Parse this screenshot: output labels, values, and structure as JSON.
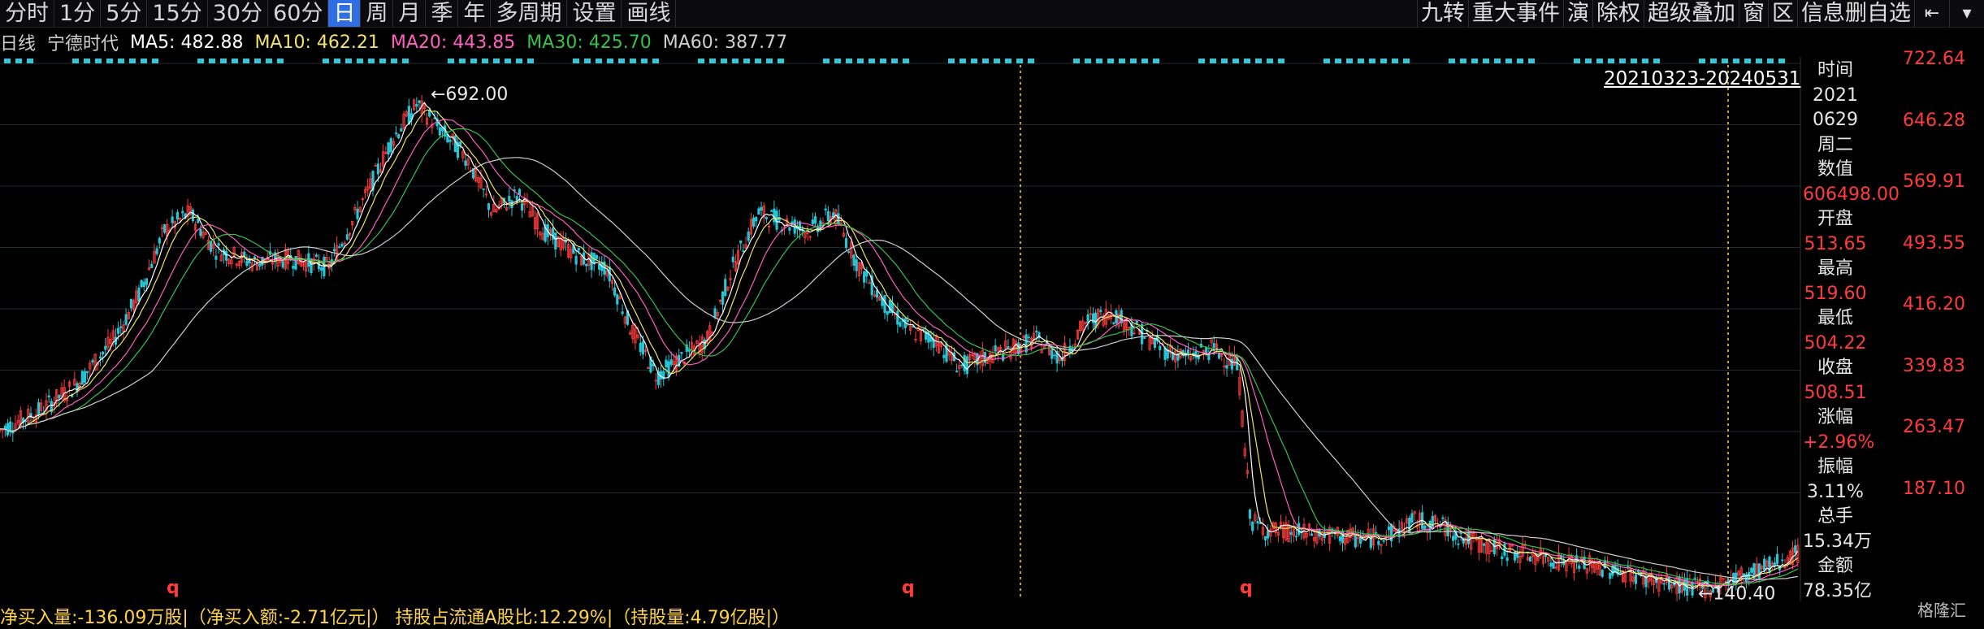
{
  "toolbar": {
    "periods": [
      "分时",
      "1分",
      "5分",
      "15分",
      "30分",
      "60分",
      "日",
      "周",
      "月",
      "季",
      "年",
      "多周期",
      "设置",
      "画线"
    ],
    "active_period": "日",
    "right_items": [
      "九转",
      "重大事件",
      "演",
      "除权",
      "超级叠加",
      "窗",
      "区",
      "信息删自选"
    ]
  },
  "legend": {
    "period": "日线",
    "stock_name": "宁德时代",
    "ma5": "MA5: 482.88",
    "ma10": "MA10: 462.21",
    "ma20": "MA20: 443.85",
    "ma30": "MA30: 425.70",
    "ma60": "MA60: 387.77",
    "colors": {
      "ma5": "#ffffff",
      "ma10": "#f0e26b",
      "ma20": "#ff5fbf",
      "ma30": "#36c24a",
      "ma60": "#cfcfcf"
    }
  },
  "range_label": "20210323-20240531",
  "info_panel": {
    "time_label": "时间",
    "year": "2021",
    "date": "0629",
    "weekday": "周二",
    "value_label": "数值",
    "value": "606498.00",
    "open_label": "开盘",
    "open": "513.65",
    "high_label": "最高",
    "high": "519.60",
    "low_label": "最低",
    "low": "504.22",
    "close_label": "收盘",
    "close": "508.51",
    "change_label": "涨幅",
    "change": "+2.96%",
    "amplitude_label": "振幅",
    "amplitude": "3.11%",
    "volume_label": "总手",
    "volume": "15.34万",
    "amount_label": "金额",
    "amount": "78.35亿"
  },
  "chart_data": {
    "type": "candlestick",
    "y_ticks": [
      "722.64",
      "646.28",
      "569.91",
      "493.55",
      "416.20",
      "339.83",
      "263.47",
      "187.10"
    ],
    "ylim": [
      140,
      725
    ],
    "max_label": "692.00",
    "min_label": "140.40",
    "markers": [
      "q",
      "q",
      "q"
    ],
    "trend_points": [
      [
        0,
        320
      ],
      [
        30,
        340
      ],
      [
        60,
        370
      ],
      [
        90,
        420
      ],
      [
        110,
        470
      ],
      [
        130,
        540
      ],
      [
        150,
        560
      ],
      [
        170,
        520
      ],
      [
        200,
        505
      ],
      [
        230,
        510
      ],
      [
        260,
        500
      ],
      [
        290,
        580
      ],
      [
        310,
        640
      ],
      [
        330,
        680
      ],
      [
        350,
        650
      ],
      [
        370,
        620
      ],
      [
        390,
        560
      ],
      [
        410,
        580
      ],
      [
        430,
        540
      ],
      [
        460,
        510
      ],
      [
        480,
        500
      ],
      [
        500,
        430
      ],
      [
        520,
        380
      ],
      [
        540,
        400
      ],
      [
        560,
        420
      ],
      [
        580,
        500
      ],
      [
        600,
        560
      ],
      [
        620,
        550
      ],
      [
        640,
        540
      ],
      [
        660,
        560
      ],
      [
        680,
        500
      ],
      [
        700,
        460
      ],
      [
        720,
        430
      ],
      [
        740,
        420
      ],
      [
        760,
        390
      ],
      [
        780,
        400
      ],
      [
        800,
        410
      ],
      [
        820,
        420
      ],
      [
        840,
        400
      ],
      [
        860,
        440
      ],
      [
        880,
        450
      ],
      [
        900,
        430
      ],
      [
        920,
        410
      ],
      [
        940,
        400
      ],
      [
        960,
        410
      ],
      [
        980,
        390
      ],
      [
        990,
        220
      ],
      [
        1000,
        210
      ],
      [
        1040,
        205
      ],
      [
        1080,
        200
      ],
      [
        1100,
        205
      ],
      [
        1120,
        220
      ],
      [
        1140,
        215
      ],
      [
        1160,
        200
      ],
      [
        1180,
        190
      ],
      [
        1200,
        185
      ],
      [
        1240,
        175
      ],
      [
        1280,
        165
      ],
      [
        1320,
        150
      ],
      [
        1350,
        145
      ],
      [
        1380,
        160
      ],
      [
        1400,
        170
      ],
      [
        1425,
        185
      ]
    ]
  },
  "bottom_bar": "净买入量:-136.09万股|（净买入额:-2.71亿元|）  持股占流通A股比:12.29%|（持股量:4.79亿股|）",
  "brand": "格隆汇"
}
